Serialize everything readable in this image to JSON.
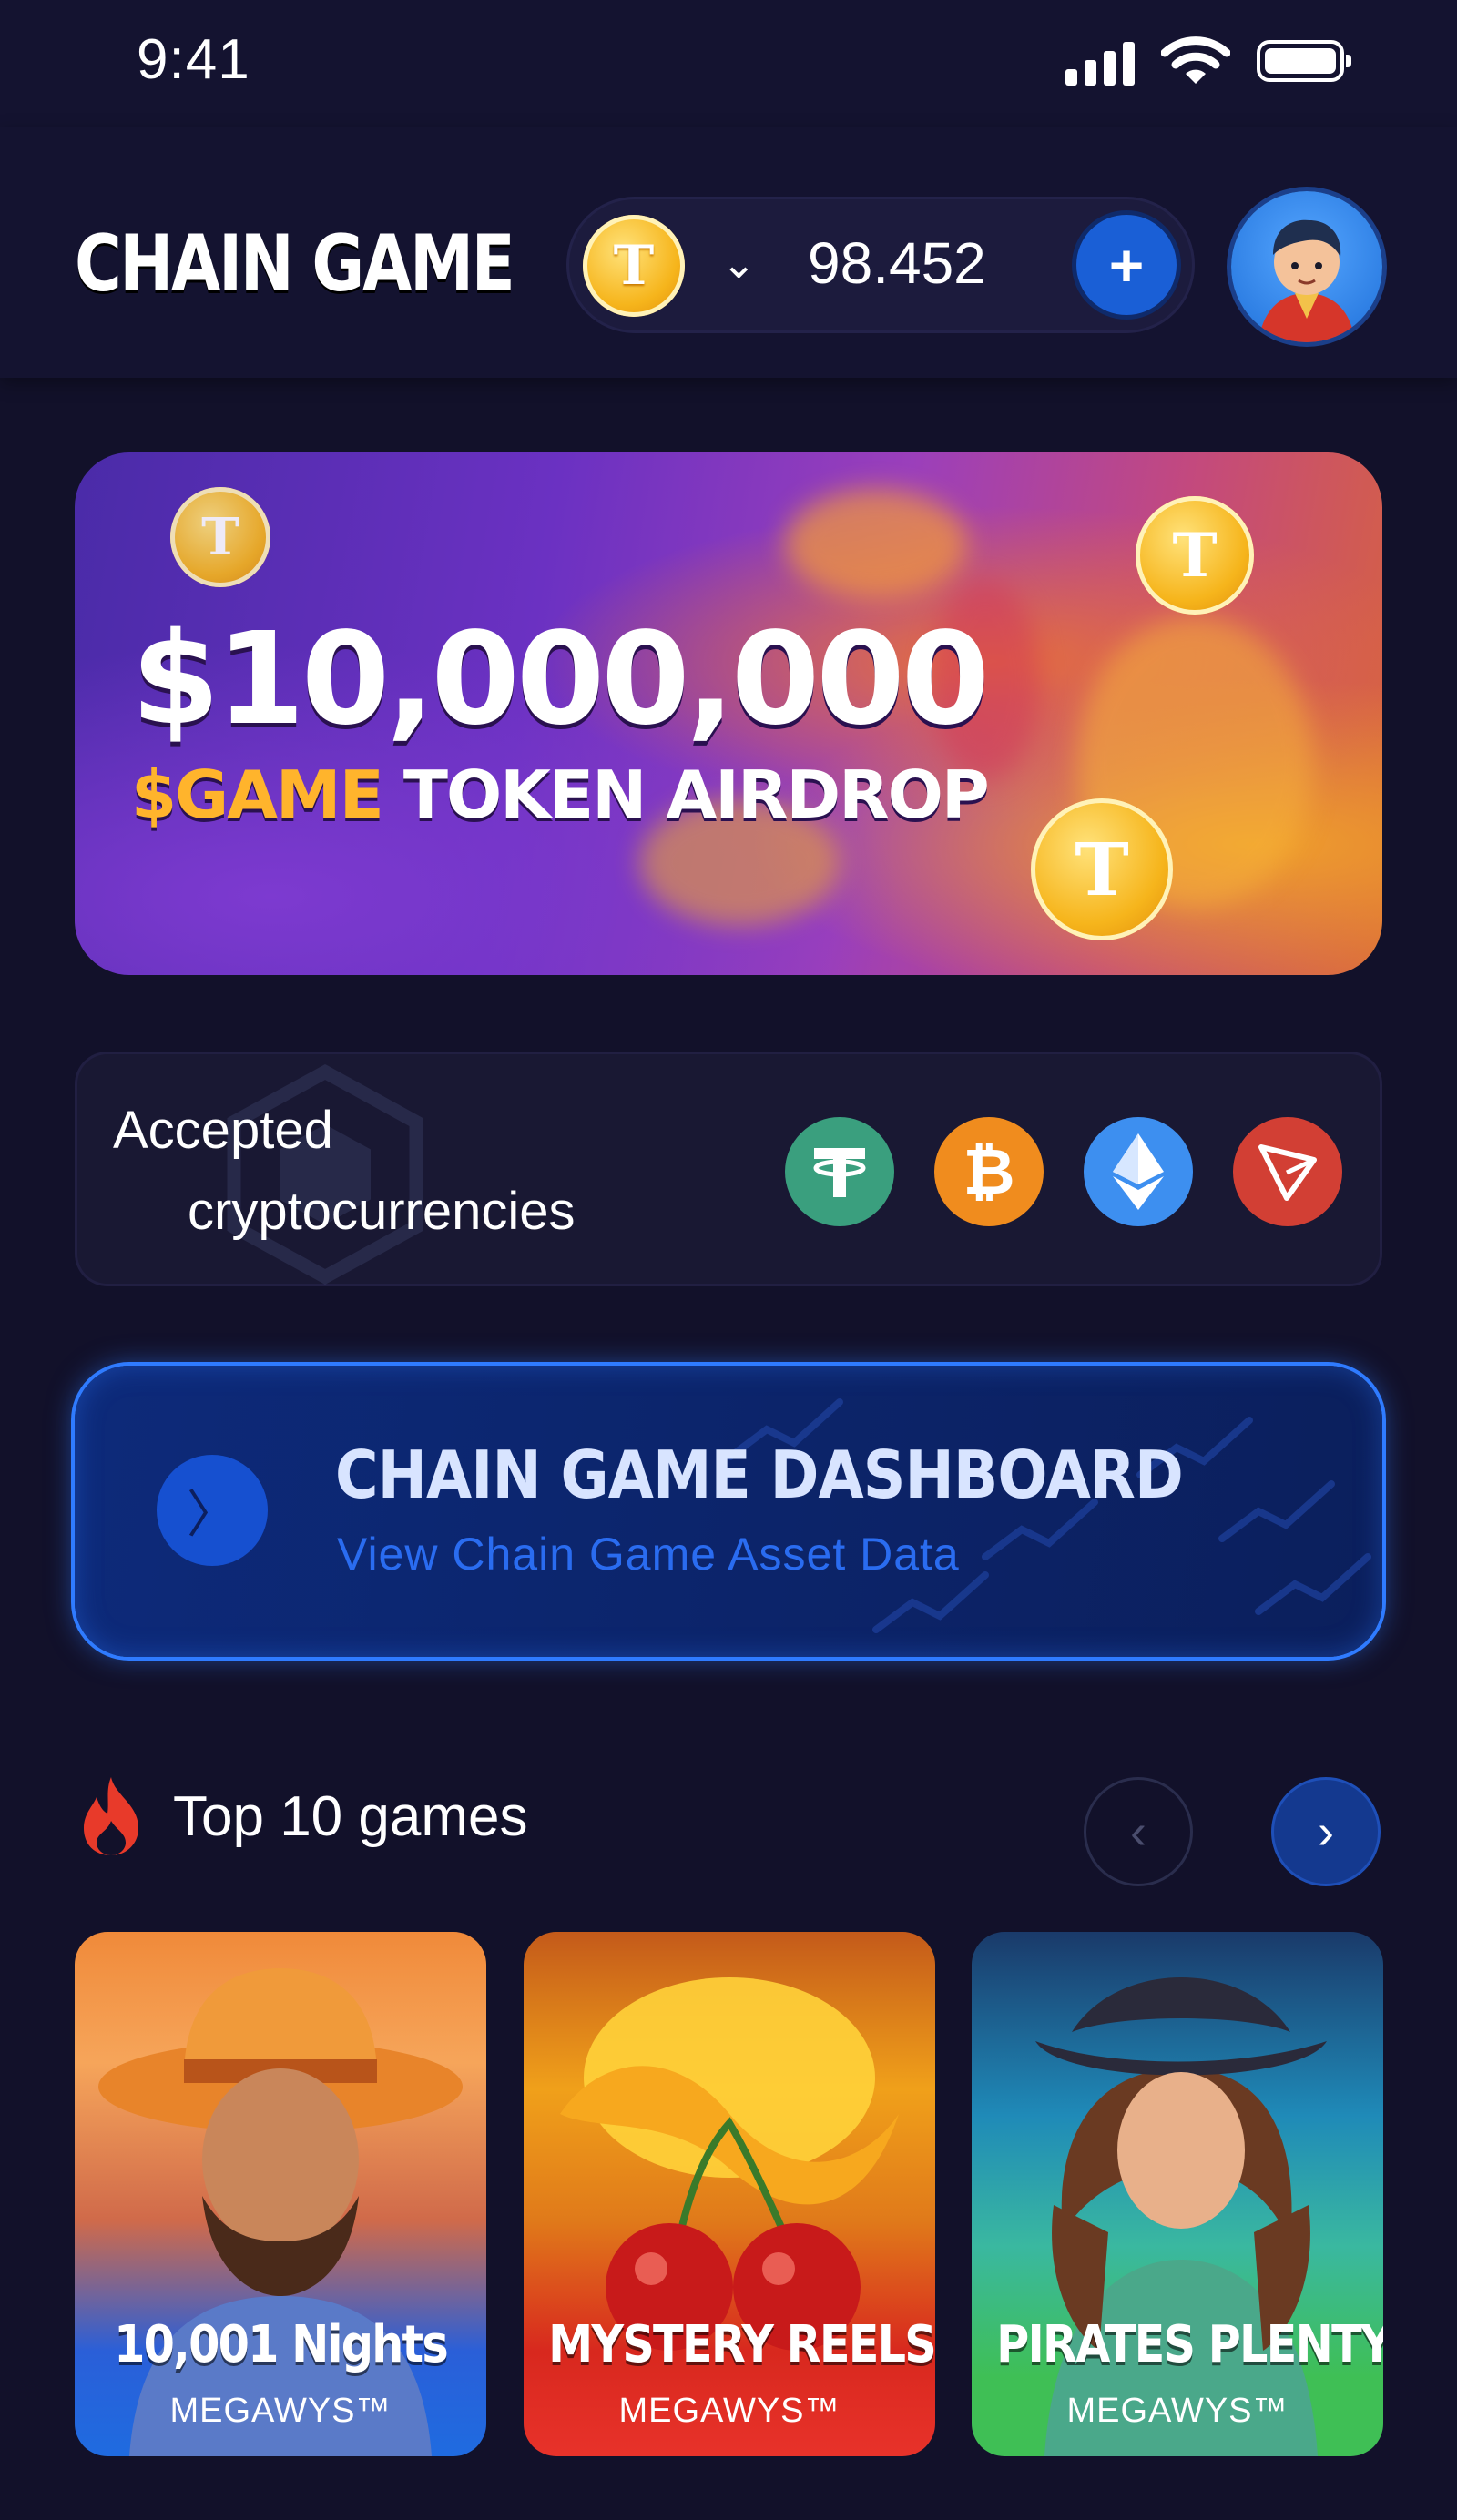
{
  "status": {
    "time": "9:41"
  },
  "header": {
    "logo": "CHAIN GAME",
    "wallet": {
      "currency_icon": "game-token-icon",
      "token_letter": "T",
      "balance": "98.452"
    },
    "add_label": "+"
  },
  "banner": {
    "amount": "$10,000,000",
    "token": "$GAME",
    "suffix": "TOKEN AIRDROP"
  },
  "crypto": {
    "label_line1": "Accepted",
    "label_line2": "cryptocurrencies",
    "coins": [
      {
        "name": "tether",
        "symbol": "₮",
        "color": "#3a9f7e"
      },
      {
        "name": "bitcoin",
        "symbol": "₿",
        "color": "#f08c1e"
      },
      {
        "name": "ethereum",
        "symbol": "",
        "color": "#3d8ff0"
      },
      {
        "name": "tron",
        "symbol": "",
        "color": "#d23f34"
      }
    ]
  },
  "dashboard": {
    "title": "CHAIN GAME DASHBOARD",
    "subtitle": "View Chain Game Asset Data"
  },
  "top_games": {
    "title": "Top 10 games",
    "games": [
      {
        "title": "10,001 Nights",
        "provider": "MEGAWYS™",
        "theme_color": "#1f6be0"
      },
      {
        "title": "MYSTERY REELS",
        "provider": "MEGAWYS™",
        "theme_color": "#e8322a"
      },
      {
        "title": "PIRATES PLENTY",
        "provider": "MEGAWYS™",
        "theme_color": "#3fbf55"
      }
    ]
  },
  "colors": {
    "background": "#12112a",
    "accent_blue": "#2f7bff",
    "gold": "#ffb42c"
  }
}
